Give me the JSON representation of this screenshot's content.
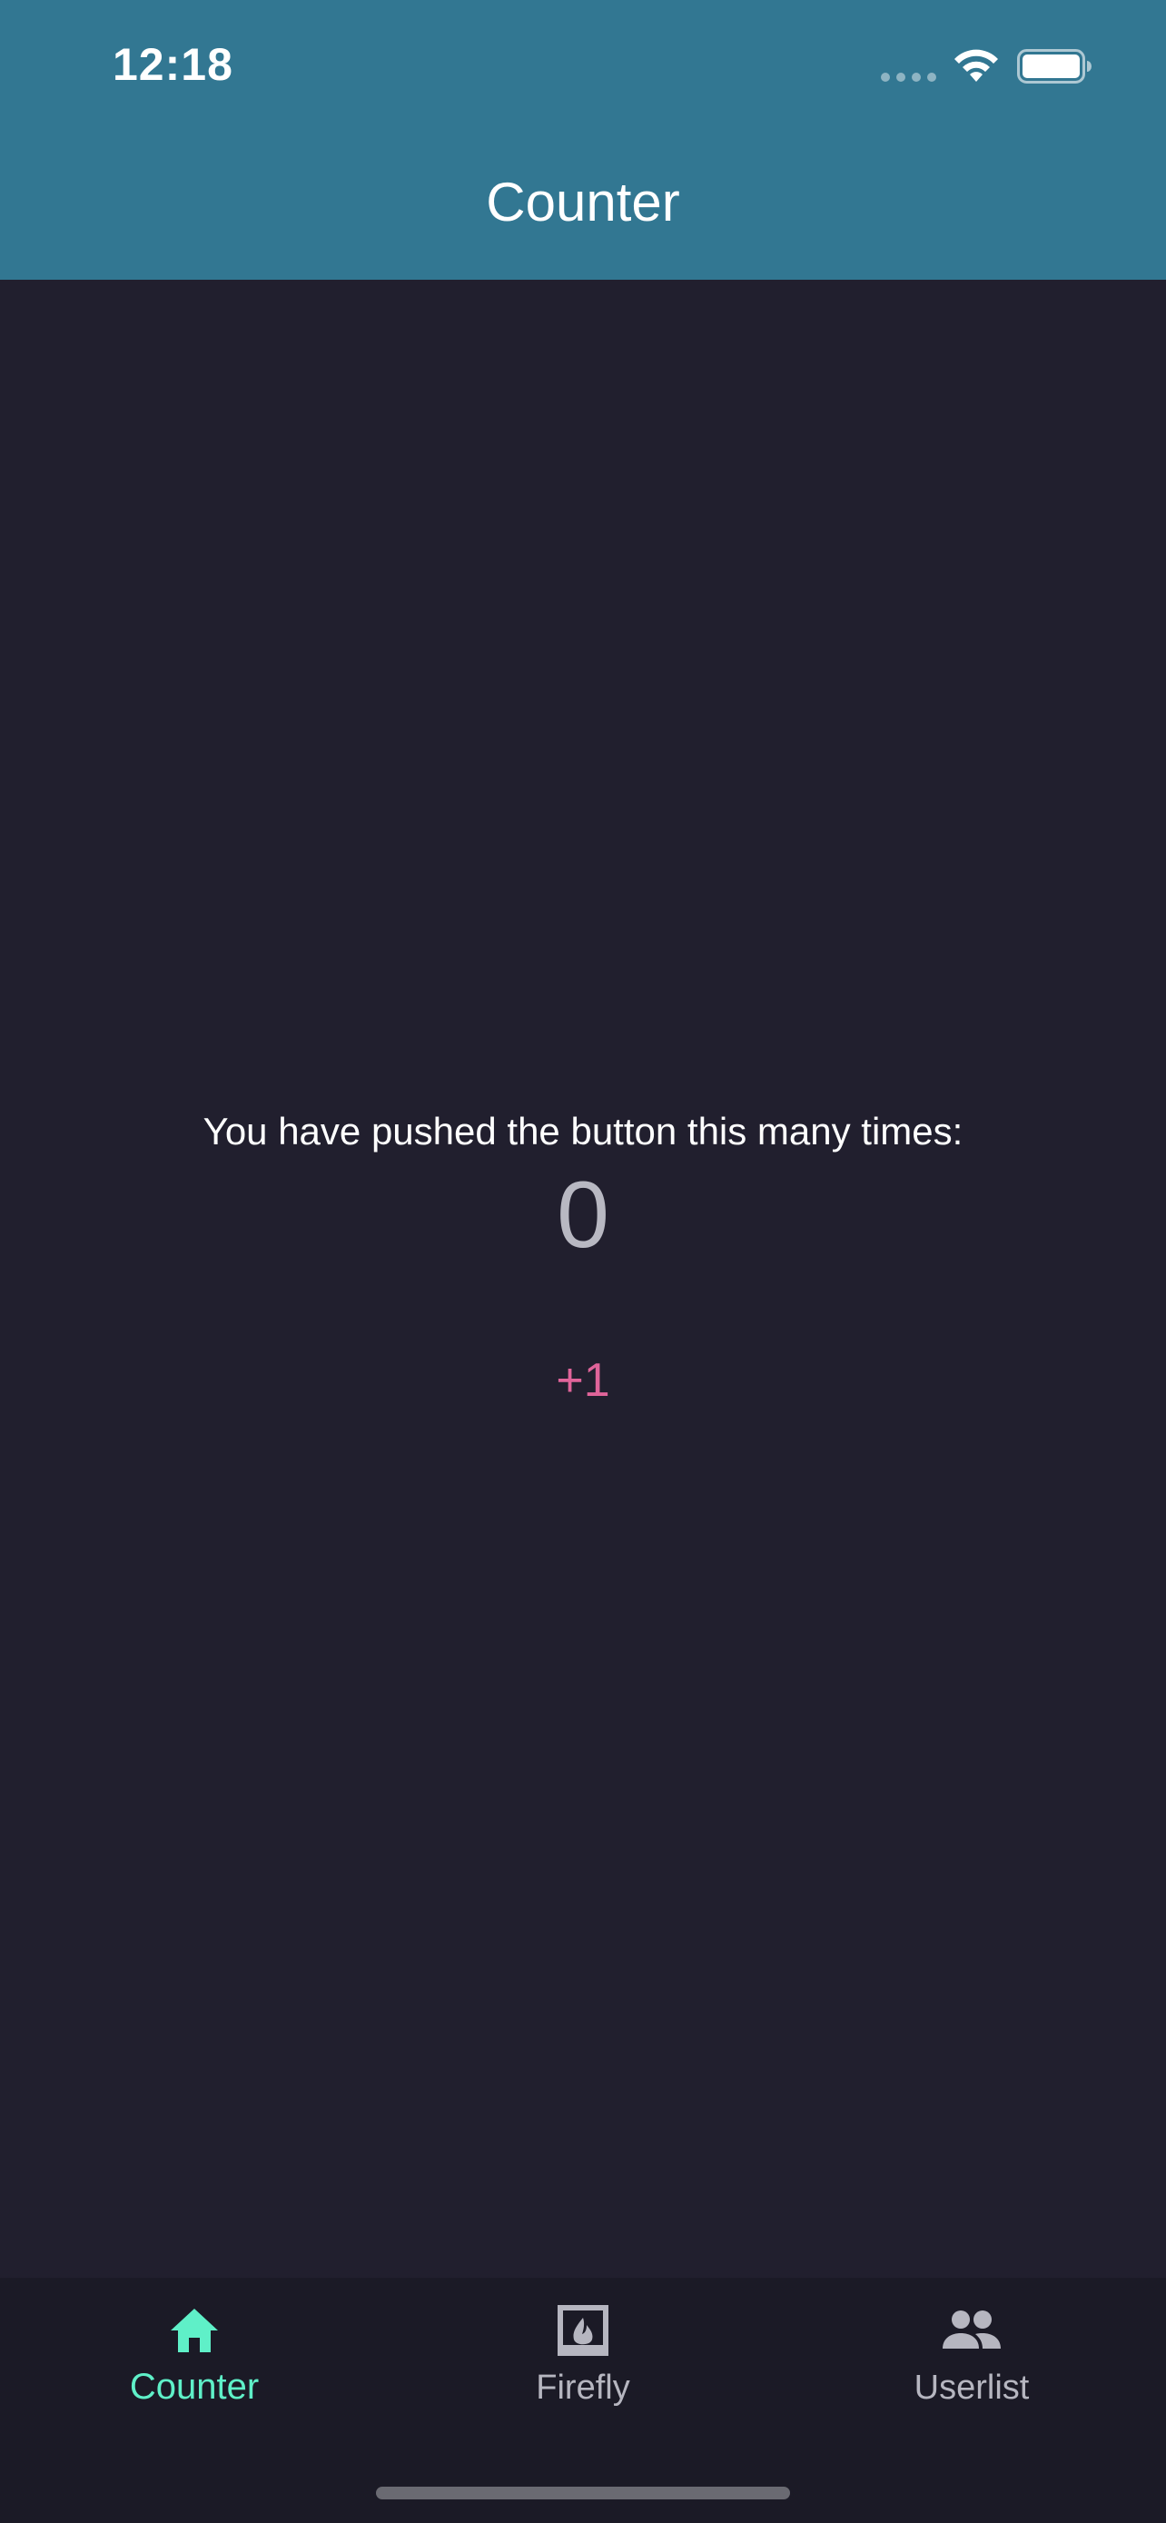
{
  "status_bar": {
    "time": "12:18"
  },
  "app_bar": {
    "title": "Counter",
    "background_color": "#327792"
  },
  "main": {
    "label": "You have pushed the button this many times:",
    "count": "0",
    "increment_label": "+1",
    "increment_color": "#e0649a"
  },
  "bottom_nav": {
    "items": [
      {
        "label": "Counter",
        "icon": "home-icon",
        "active": true,
        "color": "#5ff0c8"
      },
      {
        "label": "Firefly",
        "icon": "fireplace-icon",
        "active": false,
        "color": "#b6b6c0"
      },
      {
        "label": "Userlist",
        "icon": "people-icon",
        "active": false,
        "color": "#b6b6c0"
      }
    ]
  },
  "colors": {
    "background": "#211f2e",
    "nav_background": "#1b1a26"
  }
}
